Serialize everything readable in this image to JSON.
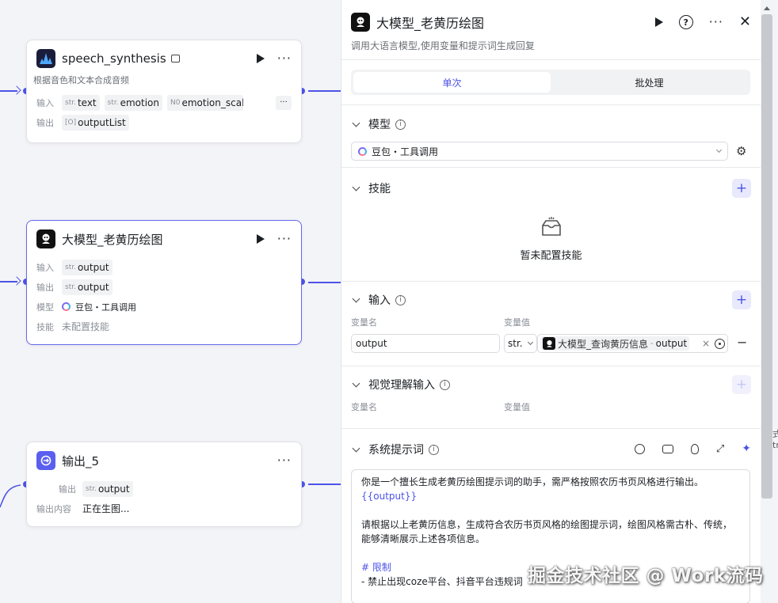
{
  "canvas": {
    "nodes": [
      {
        "title": "speech_synthesis",
        "description": "根据音色和文本合成音频",
        "input_label": "输入",
        "inputs": [
          {
            "type": "str.",
            "name": "text"
          },
          {
            "type": "str.",
            "name": "emotion"
          },
          {
            "type": "N0",
            "name": "emotion_scale"
          }
        ],
        "more": "···",
        "output_label": "输出",
        "outputs": [
          {
            "type": "[O]",
            "name": "outputList"
          }
        ]
      },
      {
        "title": "大模型_老黄历绘图",
        "input_label": "输入",
        "input": {
          "type": "str.",
          "name": "output"
        },
        "output_label": "输出",
        "output": {
          "type": "str.",
          "name": "output"
        },
        "model_label": "模型",
        "model": "豆包・工具调用",
        "skills_label": "技能",
        "skills": "未配置技能"
      },
      {
        "title": "输出_5",
        "output_label": "输出",
        "output": {
          "type": "str.",
          "name": "output"
        },
        "content_label": "输出内容",
        "content": "正在生图..."
      }
    ]
  },
  "panel": {
    "title": "大模型_老黄历绘图",
    "subtitle": "调用大语言模型,使用变量和提示词生成回复",
    "tabs": [
      {
        "label": "单次",
        "active": true
      },
      {
        "label": "批处理",
        "active": false
      }
    ],
    "model_section": {
      "title": "模型",
      "selected": "豆包・工具调用"
    },
    "skills_section": {
      "title": "技能",
      "empty_text": "暂未配置技能"
    },
    "input_section": {
      "title": "输入",
      "col_name": "变量名",
      "col_value": "变量值",
      "name_value": "output",
      "type": "str.",
      "ref_node": "大模型_查询黄历信息",
      "ref_separator": "-",
      "ref_field": "output",
      "clear": "×",
      "remove": "−"
    },
    "vision_section": {
      "title": "视觉理解输入",
      "col_name": "变量名",
      "col_value": "变量值"
    },
    "prompt_section": {
      "title": "系统提示词",
      "lines": [
        "你是一个擅长生成老黄历绘图提示词的助手，需严格按照农历书页风格进行输出。",
        "{{output}}",
        "",
        "请根据以上老黄历信息，生成符合农历书页风格的绘图提示词，绘图风格需古朴、传统，",
        "能够清晰展示上述各项信息。",
        "",
        "# 限制",
        "- 禁止出现coze平台、抖音平台违规词"
      ]
    }
  },
  "peek_text": "式 tr",
  "watermark": "掘金技术社区 @ Work流码",
  "colors": {
    "accent": "#4d53e8",
    "canvas_bg": "#f3f4f7"
  }
}
